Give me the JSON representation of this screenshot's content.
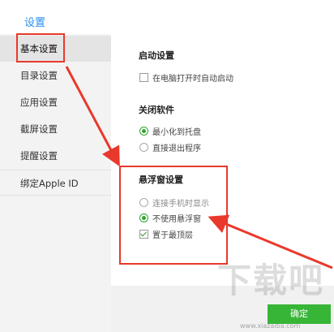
{
  "window": {
    "title": "设置"
  },
  "sidebar": {
    "items": [
      {
        "label": "基本设置"
      },
      {
        "label": "目录设置"
      },
      {
        "label": "应用设置"
      },
      {
        "label": "截屏设置"
      },
      {
        "label": "提醒设置"
      },
      {
        "label": "绑定Apple ID"
      }
    ]
  },
  "sections": {
    "startup": {
      "title": "启动设置",
      "options": [
        {
          "label": "在电脑打开时自动启动",
          "checked": false
        }
      ]
    },
    "close": {
      "title": "关闭软件",
      "options": [
        {
          "label": "最小化到托盘",
          "selected": true
        },
        {
          "label": "直接退出程序",
          "selected": false
        }
      ]
    },
    "floating": {
      "title": "悬浮窗设置",
      "options": [
        {
          "label": "连接手机时显示",
          "selected": false
        },
        {
          "label": "不使用悬浮窗",
          "selected": true
        },
        {
          "label": "置于最顶层",
          "checked": true
        }
      ]
    }
  },
  "footer": {
    "confirm_label": "确定"
  },
  "watermark": {
    "text": "下载吧",
    "url": "www.xiazaiba.com"
  },
  "colors": {
    "accent": "#2a8ef0",
    "annotation": "#e8392c",
    "confirm": "#37b537"
  }
}
